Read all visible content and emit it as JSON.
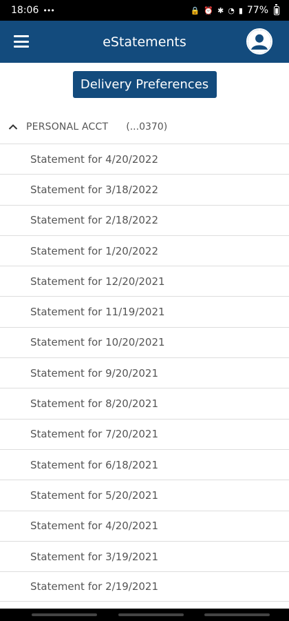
{
  "status_bar": {
    "time": "18:06",
    "battery": "77%"
  },
  "app_bar": {
    "title": "eStatements"
  },
  "delivery_button_label": "Delivery Preferences",
  "account": {
    "name": "PERSONAL ACCT",
    "number": "(...0370)"
  },
  "statements": [
    "Statement for 4/20/2022",
    "Statement for 3/18/2022",
    "Statement for 2/18/2022",
    "Statement for 1/20/2022",
    "Statement for 12/20/2021",
    "Statement for 11/19/2021",
    "Statement for 10/20/2021",
    "Statement for 9/20/2021",
    "Statement for 8/20/2021",
    "Statement for 7/20/2021",
    "Statement for 6/18/2021",
    "Statement for 5/20/2021",
    "Statement for 4/20/2021",
    "Statement for 3/19/2021",
    "Statement for 2/19/2021"
  ],
  "colors": {
    "primary": "#134b7d",
    "text": "#555555",
    "divider": "#dddddd"
  },
  "icons": {
    "menu": "hamburger-icon",
    "profile": "user-icon",
    "collapse": "chevron-up-icon"
  }
}
